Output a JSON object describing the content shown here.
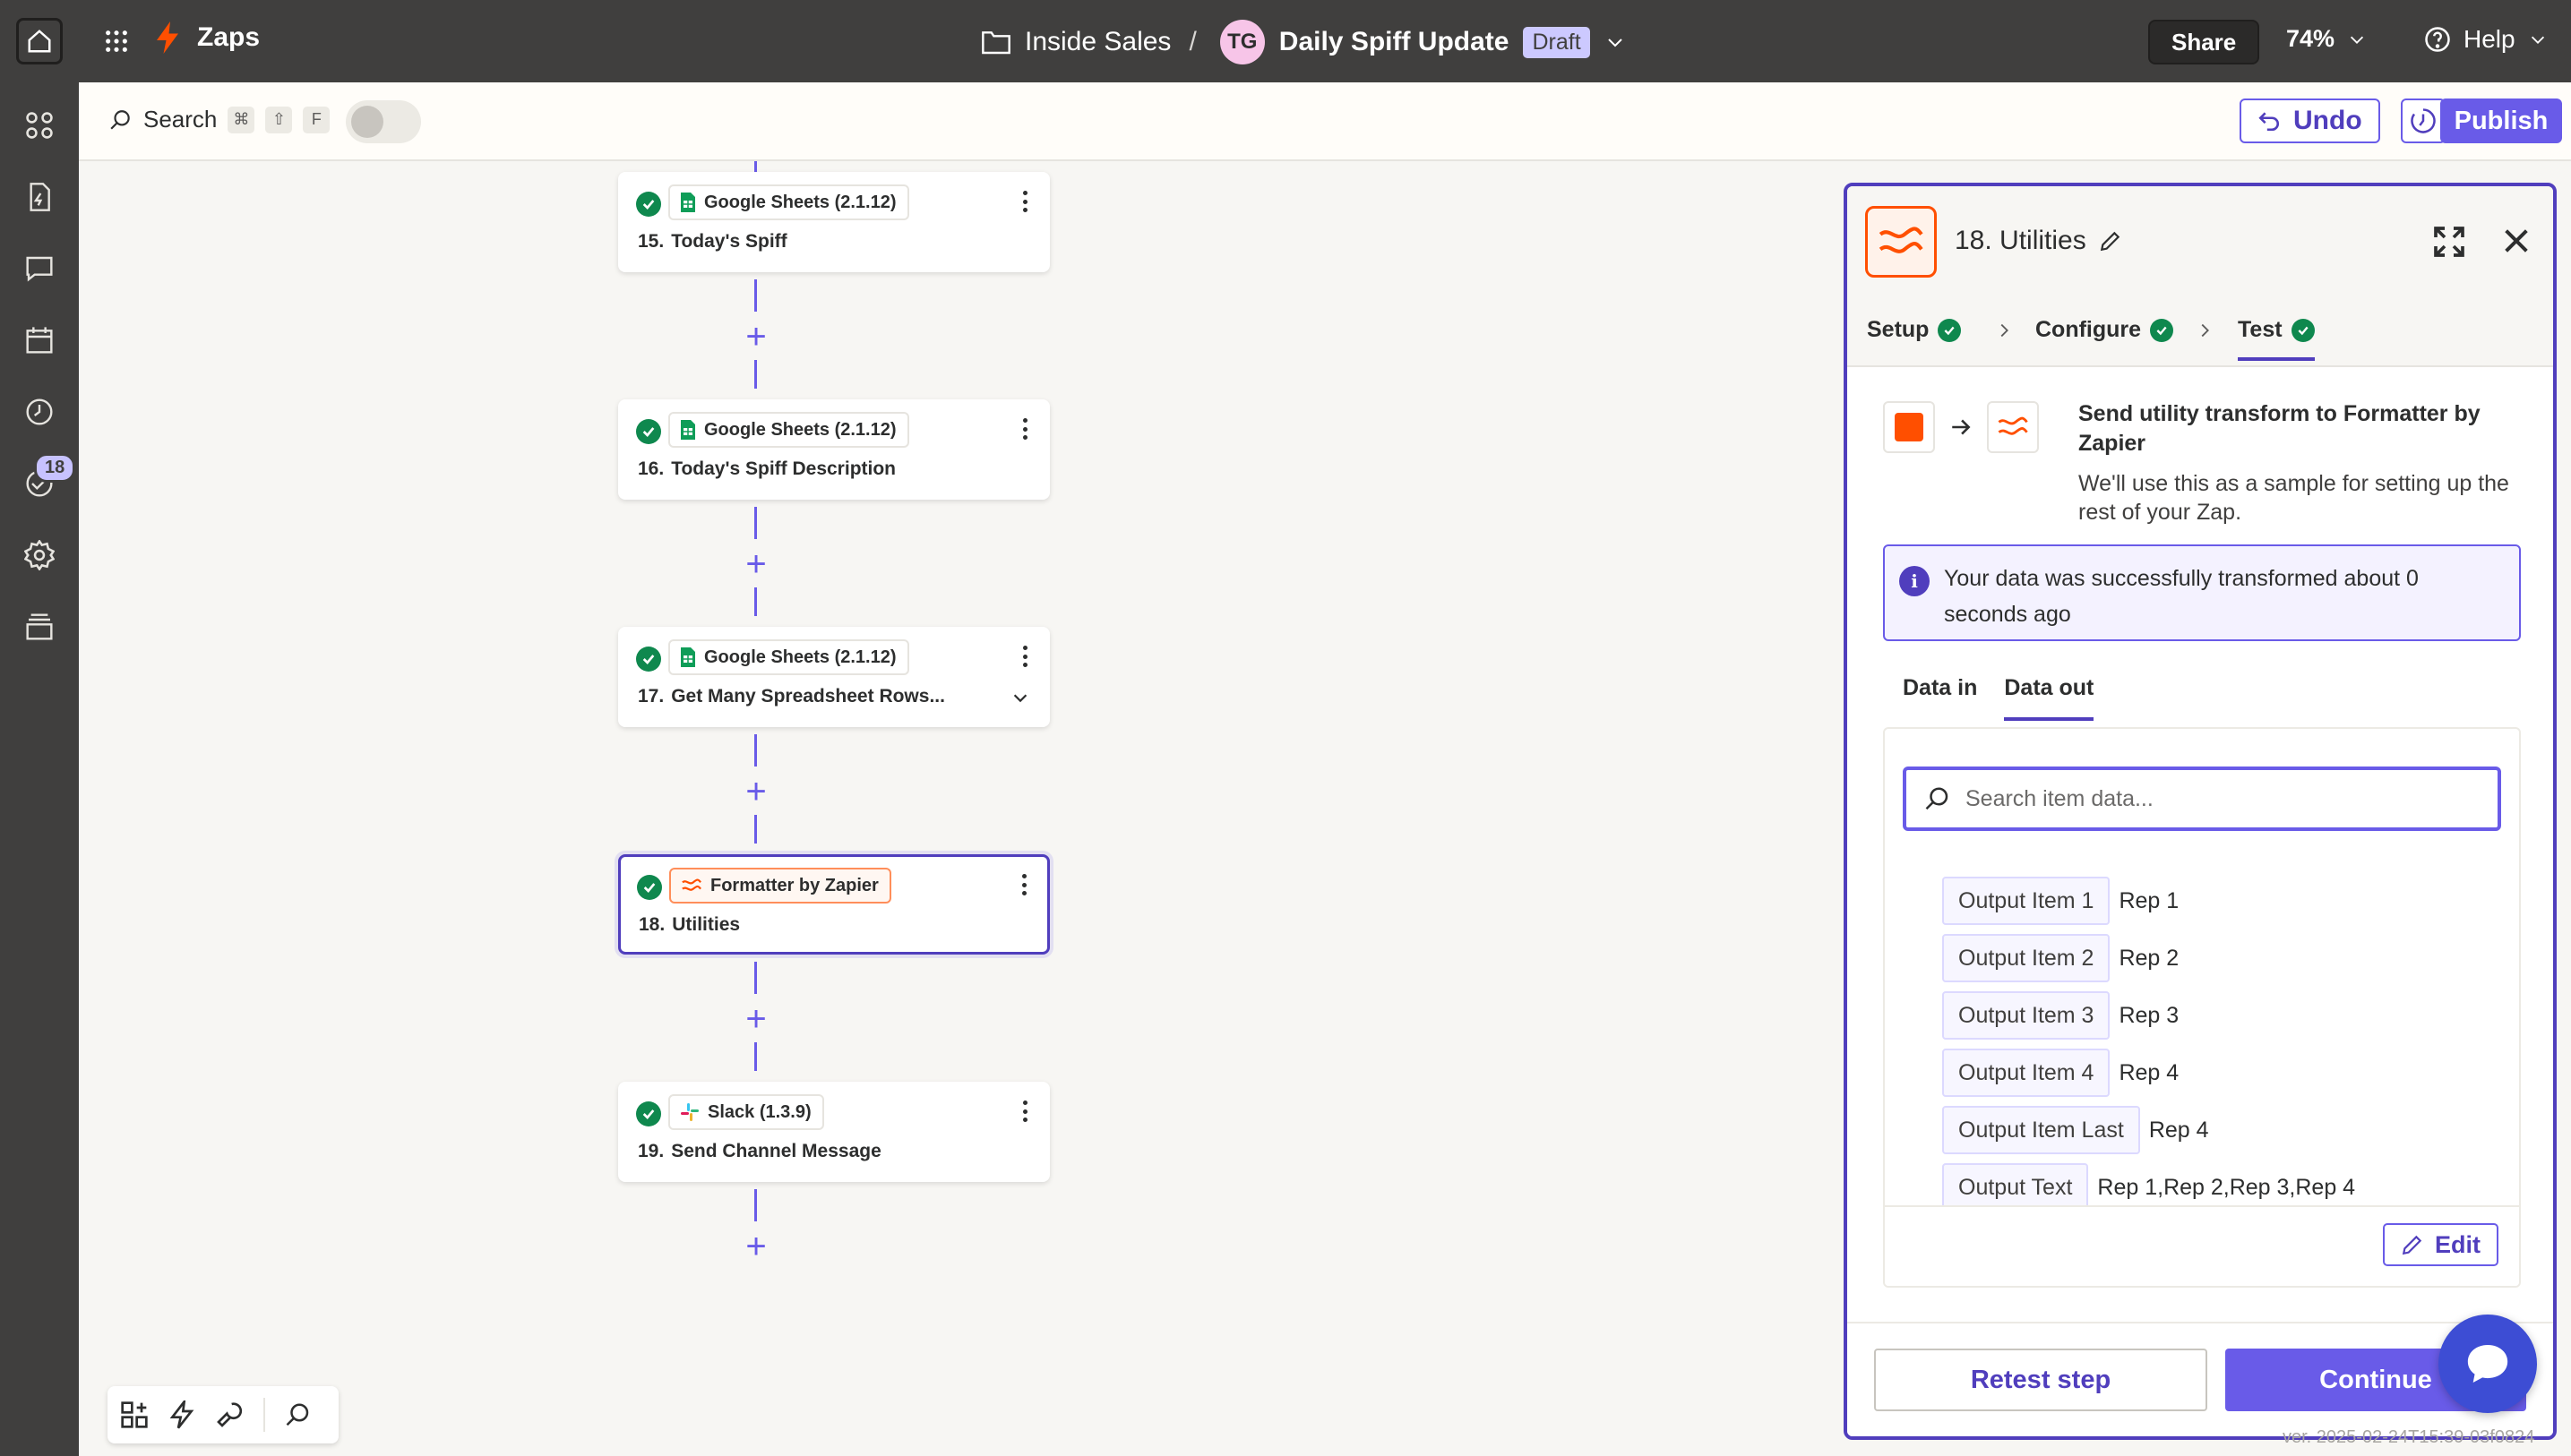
{
  "topbar": {
    "zaps_label": "Zaps",
    "folder": "Inside Sales",
    "separator": "/",
    "avatar_initials": "TG",
    "zap_name": "Daily Spiff Update",
    "status_badge": "Draft",
    "share_label": "Share",
    "zoom": "74%",
    "help_label": "Help"
  },
  "rail": {
    "badge_count": "18"
  },
  "toolbar": {
    "search_label": "Search",
    "shortcut_keys": [
      "⌘",
      "⇧",
      "F"
    ],
    "undo_label": "Undo",
    "publish_label": "Publish"
  },
  "steps": [
    {
      "app": "Google Sheets (2.1.12)",
      "number": "15.",
      "title": "Today's Spiff"
    },
    {
      "app": "Google Sheets (2.1.12)",
      "number": "16.",
      "title": "Today's Spiff Description"
    },
    {
      "app": "Google Sheets (2.1.12)",
      "number": "17.",
      "title": "Get Many Spreadsheet Rows..."
    },
    {
      "app": "Formatter by Zapier",
      "number": "18.",
      "title": "Utilities"
    },
    {
      "app": "Slack (1.3.9)",
      "number": "19.",
      "title": "Send Channel Message"
    }
  ],
  "panel": {
    "title": "18. Utilities",
    "tabs": {
      "setup": "Setup",
      "configure": "Configure",
      "test": "Test"
    },
    "send_title": "Send utility transform to Formatter by Zapier",
    "send_desc": "We'll use this as a sample for setting up the rest of your Zap.",
    "info_text": "Your data was successfully transformed about 0 seconds ago",
    "data_tabs": {
      "in": "Data in",
      "out": "Data out"
    },
    "search_placeholder": "Search item data...",
    "output": [
      {
        "key": "Output Item 1",
        "value": "Rep 1"
      },
      {
        "key": "Output Item 2",
        "value": "Rep 2"
      },
      {
        "key": "Output Item 3",
        "value": "Rep 3"
      },
      {
        "key": "Output Item 4",
        "value": "Rep 4"
      },
      {
        "key": "Output Item Last",
        "value": "Rep 4"
      },
      {
        "key": "Output Text",
        "value": "Rep 1,Rep 2,Rep 3,Rep 4"
      }
    ],
    "edit_label": "Edit",
    "retest_label": "Retest step",
    "continue_label": "Continue"
  },
  "version_text": "ver. 2025-02-24T15:39-03f0824",
  "colors": {
    "accent": "#695be8",
    "accent_dark": "#503ebd",
    "success": "#0f884e",
    "brand_orange": "#ff4f00",
    "topbar": "#403f3e"
  }
}
